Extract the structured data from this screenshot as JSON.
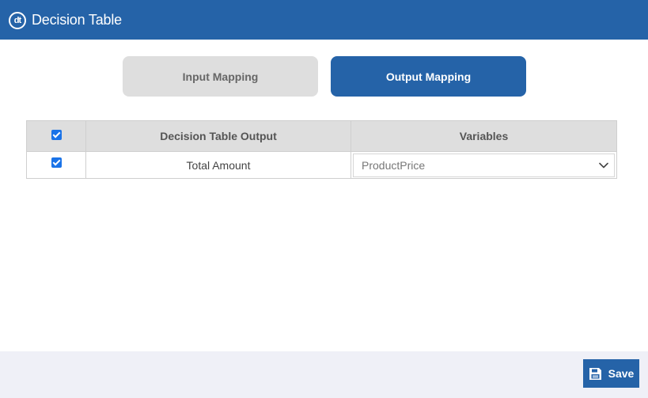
{
  "header": {
    "logo_text": "dt",
    "title": "Decision Table"
  },
  "tabs": [
    {
      "label": "Input Mapping",
      "active": false
    },
    {
      "label": "Output Mapping",
      "active": true
    }
  ],
  "table": {
    "columns": [
      "",
      "Decision Table Output",
      "Variables"
    ],
    "header_checkbox_checked": true,
    "rows": [
      {
        "checked": true,
        "output": "Total Amount",
        "variable": "ProductPrice"
      }
    ]
  },
  "footer": {
    "save_label": "Save",
    "save_icon": "floppy-disk-icon"
  },
  "colors": {
    "brand": "#2563a8",
    "tab_inactive": "#dedede",
    "table_header": "#dedede",
    "footer_bg": "#eff0f7",
    "checkbox": "#1a73e8"
  }
}
